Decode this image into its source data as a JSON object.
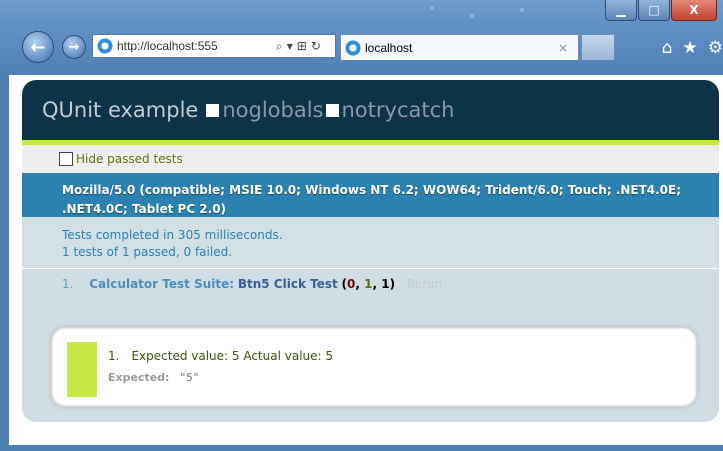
{
  "browser": {
    "address_url": "http://localhost:555",
    "tab_title": "localhost",
    "tab_close": "×",
    "window_buttons": {
      "minimize": "▁",
      "maximize": "□",
      "close": "X"
    },
    "toolbar_icons": {
      "home": "⌂",
      "favorites": "★",
      "tools": "⚙"
    },
    "nav": {
      "back": "←",
      "forward": "→"
    },
    "addr_tools": {
      "search": "⌕",
      "dropdown": "▾",
      "compat": "⊞",
      "refresh": "↻"
    }
  },
  "qunit": {
    "title": "QUnit example",
    "options": [
      "noglobals",
      "notrycatch"
    ],
    "hide_passed_label": "Hide passed tests",
    "user_agent": "Mozilla/5.0 (compatible; MSIE 10.0; Windows NT 6.2; WOW64; Trident/6.0; Touch; .NET4.0E; .NET4.0C; Tablet PC 2.0)",
    "result_line1": "Tests completed in 305 milliseconds.",
    "result_line2": "1 tests of 1 passed, 0 failed.",
    "test": {
      "number": "1.",
      "module": "Calculator Test Suite:",
      "name": "Btn5 Click Test",
      "failed": "0",
      "passed": "1",
      "total": "1",
      "rerun": "Rerun"
    },
    "assertion": {
      "number": "1.",
      "message": "Expected value: 5 Actual value: 5",
      "expected_label": "Expected:",
      "expected_value": "\"5\""
    }
  },
  "colors": {
    "header_bg": "#0d3349",
    "banner_pass": "#c6e746",
    "useragent_bg": "#2b81af",
    "chrome_blue": "#4f7fb5"
  }
}
